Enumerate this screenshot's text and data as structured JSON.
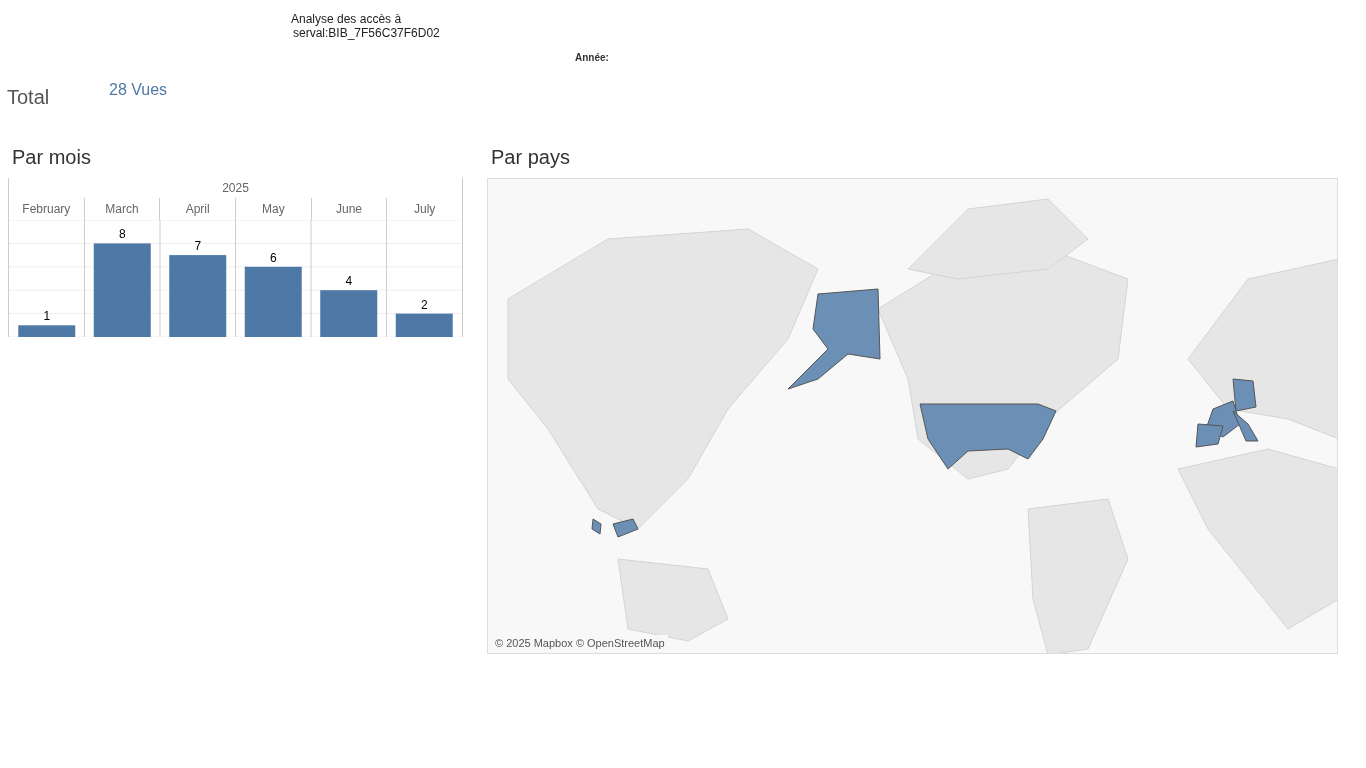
{
  "header": {
    "title_line_1": "Analyse des accès à",
    "title_line_2": "serval:BIB_7F56C37F6D02",
    "year_filter_label": "Année:"
  },
  "total": {
    "label": "Total",
    "value": "28 Vues"
  },
  "monthly": {
    "title": "Par mois",
    "year_header": "2025",
    "chart_data": {
      "type": "bar",
      "categories": [
        "February",
        "March",
        "April",
        "May",
        "June",
        "July"
      ],
      "values": [
        1,
        8,
        7,
        6,
        4,
        2
      ],
      "data_labels": true
    }
  },
  "countries": {
    "title": "Par pays",
    "attribution": "© 2025 Mapbox © OpenStreetMap"
  }
}
